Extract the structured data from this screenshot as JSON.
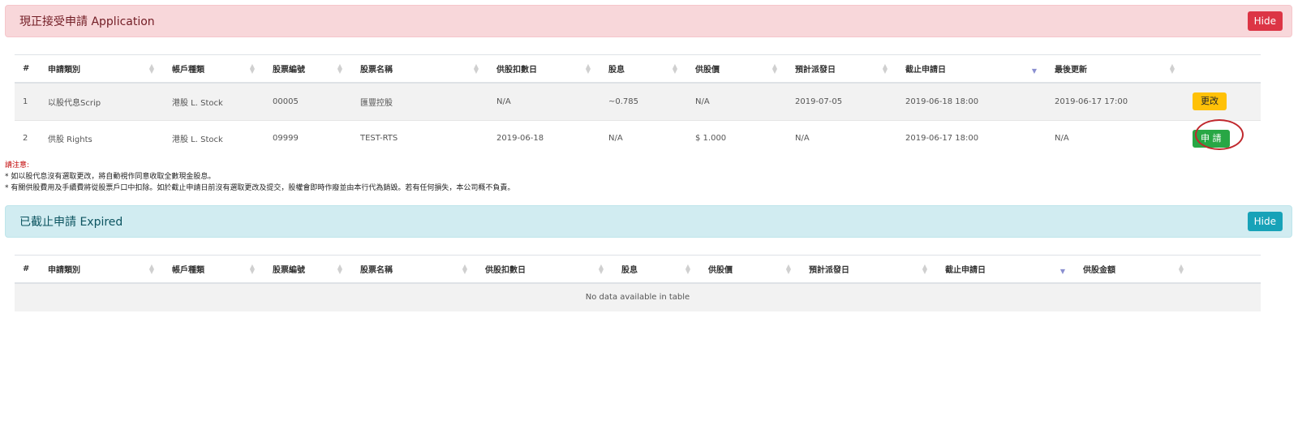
{
  "open_panel": {
    "title": "現正接受申請 Application",
    "hide_label": "Hide"
  },
  "open_table": {
    "headers": [
      "#",
      "申請類別",
      "帳戶種類",
      "股票編號",
      "股票名稱",
      "供股扣數日",
      "股息",
      "供股價",
      "預計派發日",
      "截止申請日",
      "最後更新"
    ],
    "rows": [
      {
        "no": "1",
        "type": "以股代息Scrip",
        "account": "港股 L. Stock",
        "code": "00005",
        "name": "匯豐控股",
        "deduct_date": "N/A",
        "dividend": "~0.785",
        "price": "N/A",
        "dist_date": "2019-07-05",
        "deadline": "2019-06-18 18:00",
        "updated": "2019-06-17 17:00",
        "action": "更改"
      },
      {
        "no": "2",
        "type": "供股 Rights",
        "account": "港股 L. Stock",
        "code": "09999",
        "name": "TEST-RTS",
        "deduct_date": "2019-06-18",
        "dividend": "N/A",
        "price": "$ 1.000",
        "dist_date": "N/A",
        "deadline": "2019-06-17 18:00",
        "updated": "N/A",
        "action": "申 請"
      }
    ]
  },
  "notes": {
    "title": "請注意:",
    "line1": "* 如以股代息沒有選取更改，將自動視作同意收取全數現金股息。",
    "line2": "* 有關供股費用及手續費將從股票戶口中扣除。如於截止申請日前沒有選取更改及提交，股權會即時作廢並由本行代為銷毀。若有任何損失，本公司概不負責。"
  },
  "expired_panel": {
    "title": "已截止申請 Expired",
    "hide_label": "Hide"
  },
  "expired_table": {
    "headers": [
      "#",
      "申請類別",
      "帳戶種類",
      "股票編號",
      "股票名稱",
      "供股扣數日",
      "股息",
      "供股價",
      "預計派發日",
      "截止申請日",
      "供股金額"
    ],
    "empty_message": "No data available in table"
  },
  "colors": {
    "danger": "#dc3545",
    "info": "#17a2b8",
    "warning": "#ffc107",
    "success": "#28a745",
    "annotation": "#c0282d"
  }
}
